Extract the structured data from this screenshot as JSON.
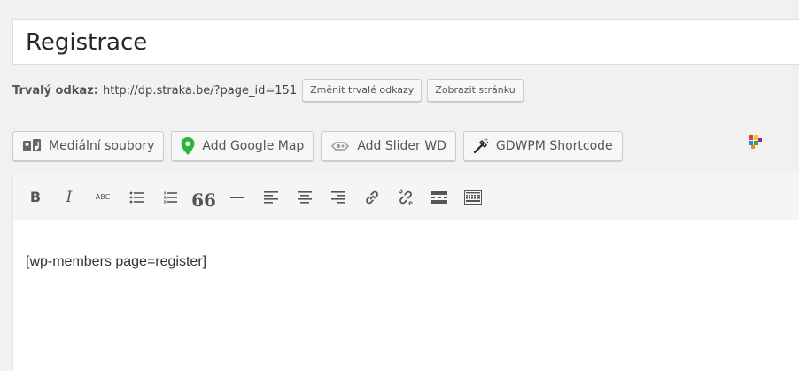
{
  "title": {
    "value": "Registrace"
  },
  "permalink": {
    "label": "Trvalý odkaz:",
    "url": "http://dp.straka.be/?page_id=151",
    "change_button": "Změnit trvalé odkazy",
    "view_button": "Zobrazit stránku"
  },
  "media_buttons": [
    {
      "label": "Mediální soubory",
      "icon": "media-icon"
    },
    {
      "label": "Add Google Map",
      "icon": "map-marker-icon",
      "color": "#2db53a"
    },
    {
      "label": "Add Slider WD",
      "icon": "slider-icon"
    },
    {
      "label": "GDWPM Shortcode",
      "icon": "wand-icon"
    }
  ],
  "toolbar": {
    "bold": "B",
    "italic": "I",
    "strikethrough": "ABC",
    "quote": "66"
  },
  "editor": {
    "content": "[wp-members page=register]"
  }
}
